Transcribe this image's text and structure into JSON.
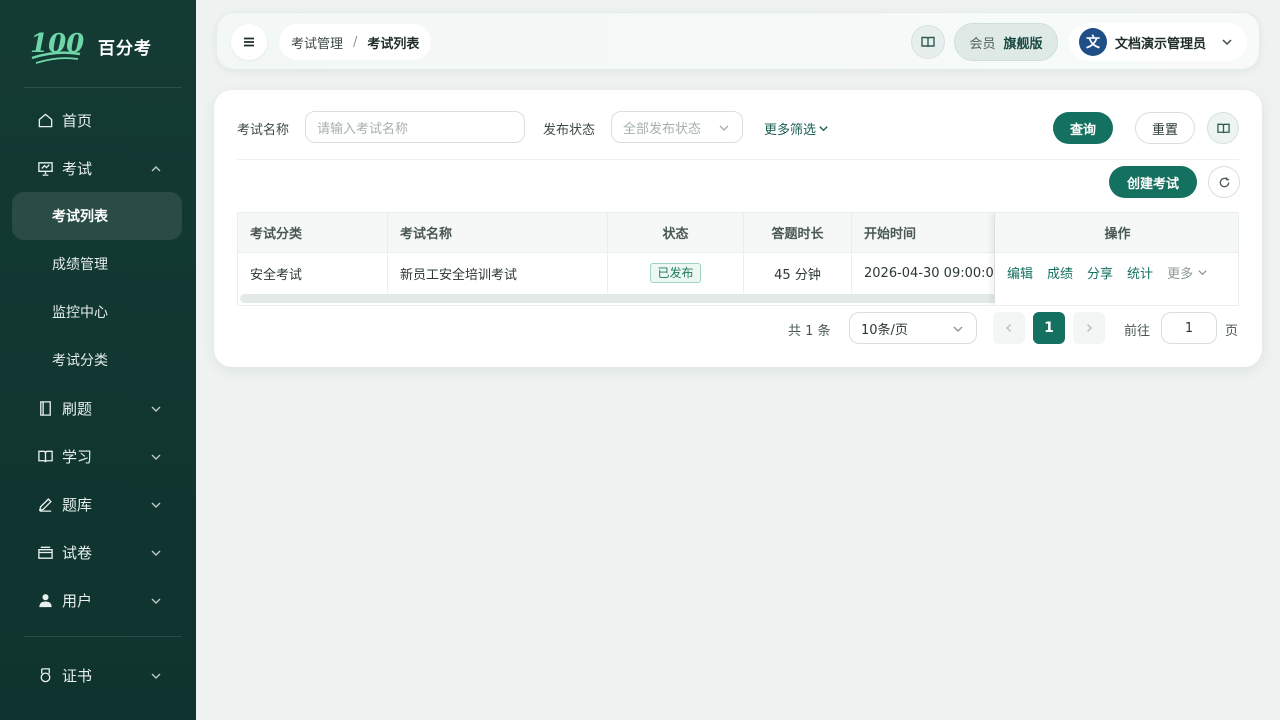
{
  "app": {
    "logo_text": "100",
    "name": "百分考"
  },
  "sidebar": {
    "items": [
      {
        "label": "首页",
        "icon": "home-icon"
      },
      {
        "label": "考试",
        "icon": "presentation-icon",
        "expanded": true,
        "children": [
          {
            "label": "考试列表",
            "active": true
          },
          {
            "label": "成绩管理"
          },
          {
            "label": "监控中心"
          },
          {
            "label": "考试分类"
          }
        ]
      },
      {
        "label": "刷题",
        "icon": "notebook-icon"
      },
      {
        "label": "学习",
        "icon": "book-open-icon"
      },
      {
        "label": "题库",
        "icon": "pen-icon"
      },
      {
        "label": "试卷",
        "icon": "paper-stack-icon"
      },
      {
        "label": "用户",
        "icon": "user-icon"
      },
      {
        "label": "证书",
        "icon": "medal-icon"
      }
    ]
  },
  "header": {
    "breadcrumb": [
      "考试管理",
      "考试列表"
    ],
    "breadcrumb_sep": "/",
    "member_label": "会员",
    "member_level": "旗舰版",
    "avatar_initial": "文",
    "user_name": "文档演示管理员"
  },
  "filters": {
    "name_label": "考试名称",
    "name_placeholder": "请输入考试名称",
    "status_label": "发布状态",
    "status_placeholder": "全部发布状态",
    "more_label": "更多筛选",
    "query_button": "查询",
    "reset_button": "重置"
  },
  "toolbar": {
    "create_button": "创建考试"
  },
  "table": {
    "headers": [
      "考试分类",
      "考试名称",
      "状态",
      "答题时长",
      "开始时间",
      "操作"
    ],
    "rows": [
      {
        "category": "安全考试",
        "name": "新员工安全培训考试",
        "status": "已发布",
        "duration": "45 分钟",
        "start_time": "2026-04-30 09:00:00",
        "actions": [
          "编辑",
          "成绩",
          "分享",
          "统计"
        ],
        "more": "更多"
      }
    ]
  },
  "pagination": {
    "total": "共 1 条",
    "page_size": "10条/页",
    "current_page": "1",
    "goto_label": "前往",
    "goto_value": "1",
    "page_unit": "页"
  },
  "colors": {
    "sidebar_bg": "#143a34",
    "primary": "#14705f",
    "badge_green": "#1a7a5e"
  }
}
